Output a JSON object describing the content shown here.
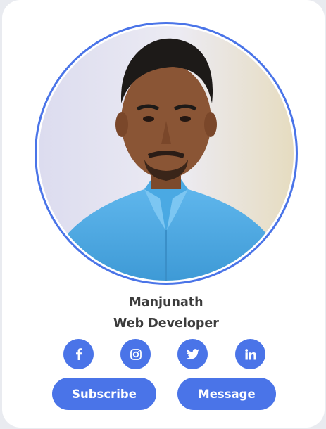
{
  "profile": {
    "name": "Manjunath",
    "role": "Web Developer",
    "photo_alt": "Profile photo"
  },
  "social": [
    {
      "network": "facebook",
      "icon": "facebook-icon"
    },
    {
      "network": "instagram",
      "icon": "instagram-icon"
    },
    {
      "network": "twitter",
      "icon": "twitter-icon"
    },
    {
      "network": "linkedin",
      "icon": "linkedin-icon"
    }
  ],
  "actions": {
    "subscribe_label": "Subscribe",
    "message_label": "Message"
  },
  "colors": {
    "accent": "#4a74e8",
    "text": "#3c3c3c",
    "card": "#ffffff",
    "page": "#e9ebf0"
  }
}
